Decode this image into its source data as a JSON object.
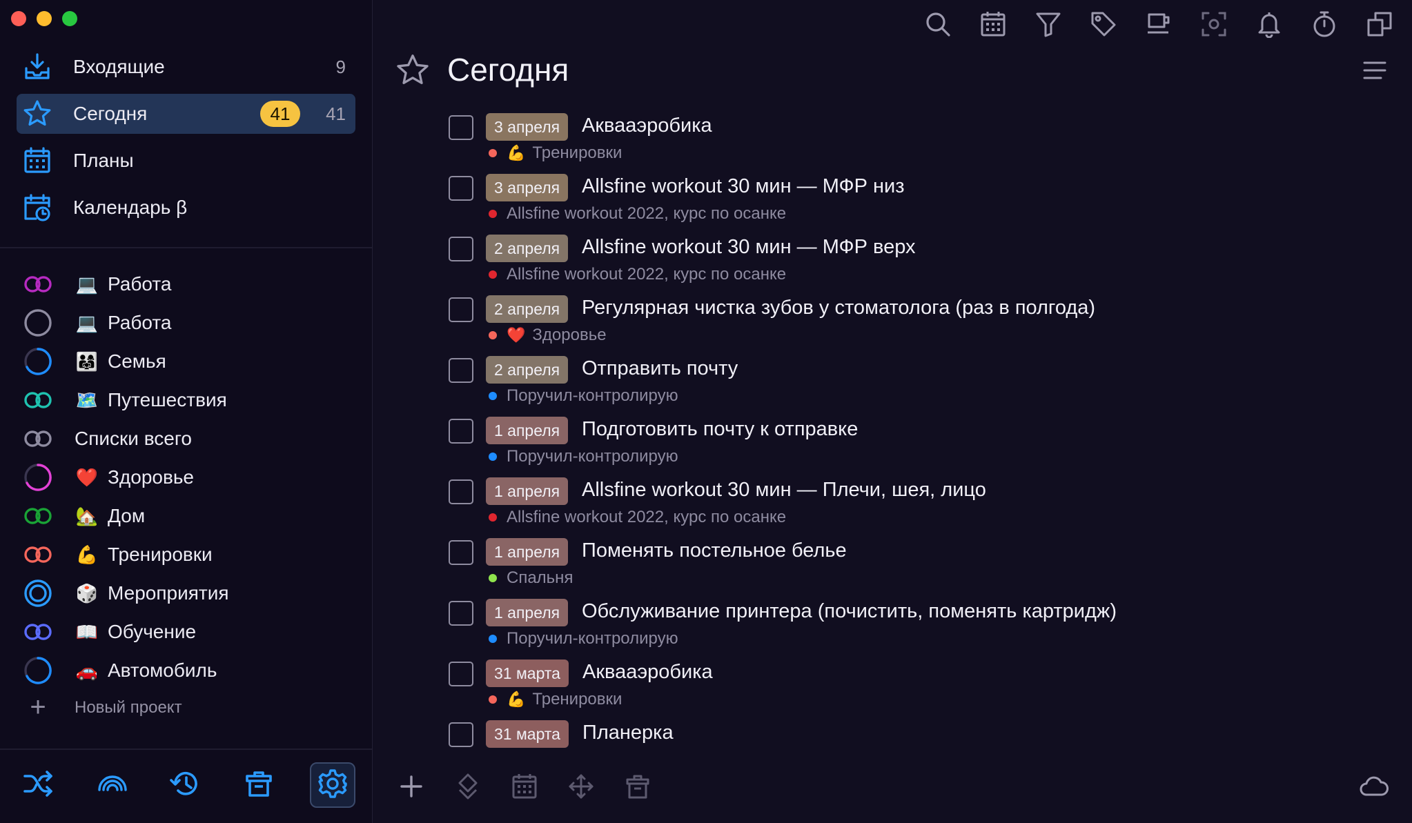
{
  "sidebar": {
    "nav": [
      {
        "label": "Входящие",
        "count": "9",
        "icon": "inbox-icon"
      },
      {
        "label": "Сегодня",
        "count": "41",
        "badge": "41",
        "icon": "star-icon",
        "active": true
      },
      {
        "label": "Планы",
        "icon": "calendar-icon"
      },
      {
        "label": "Календарь β",
        "icon": "calendar-clock-icon"
      }
    ],
    "projects": [
      {
        "emoji": "💻",
        "label": "Работа",
        "ring": "#b62ac0",
        "style": "double"
      },
      {
        "emoji": "💻",
        "label": "Работа",
        "ring": "#8e8ba0",
        "style": "circle"
      },
      {
        "emoji": "👨‍👩‍👧",
        "label": "Семья",
        "ring": "#1e8cff",
        "style": "partial"
      },
      {
        "emoji": "🗺️",
        "label": "Путешествия",
        "ring": "#1fc2b0",
        "style": "double"
      },
      {
        "emoji": "",
        "label": "Списки всего",
        "ring": "#8e8ba0",
        "style": "double"
      },
      {
        "emoji": "❤️",
        "label": "Здоровье",
        "ring": "#e341d6",
        "style": "partial"
      },
      {
        "emoji": "🏡",
        "label": "Дом",
        "ring": "#1aa336",
        "style": "double"
      },
      {
        "emoji": "💪",
        "label": "Тренировки",
        "ring": "#f5665b",
        "style": "double"
      },
      {
        "emoji": "🎲",
        "label": "Мероприятия",
        "ring": "#2b9bff",
        "style": "target"
      },
      {
        "emoji": "📖",
        "label": "Обучение",
        "ring": "#5b6cff",
        "style": "double"
      },
      {
        "emoji": "🚗",
        "label": "Автомобиль",
        "ring": "#1e8cff",
        "style": "partial"
      }
    ],
    "new_project": "Новый проект"
  },
  "main": {
    "title": "Сегодня",
    "tasks": [
      {
        "date": "3 апреля",
        "title": "Аквааэробика",
        "dot": "#f5665b",
        "emoji": "💪",
        "project": "Тренировки",
        "tag": "#8a7560"
      },
      {
        "date": "3 апреля",
        "title": "Allsfine workout 30 мин — МФР низ",
        "dot": "#e0262f",
        "emoji": "",
        "project": "Allsfine workout 2022, курс по осанке",
        "tag": "#8a7560"
      },
      {
        "date": "2 апреля",
        "title": "Allsfine workout 30 мин — МФР верх",
        "dot": "#e0262f",
        "emoji": "",
        "project": "Allsfine workout 2022, курс по осанке",
        "tag": "#837568"
      },
      {
        "date": "2 апреля",
        "title": "Регулярная чистка зубов у стоматолога (раз в полгода)",
        "dot": "#f5665b",
        "emoji": "❤️",
        "project": "Здоровье",
        "tag": "#837568"
      },
      {
        "date": "2 апреля",
        "title": "Отправить почту",
        "dot": "#1e8cff",
        "emoji": "",
        "project": "Поручил-контролирую",
        "tag": "#837568"
      },
      {
        "date": "1 апреля",
        "title": "Подготовить почту к отправке",
        "dot": "#1e8cff",
        "emoji": "",
        "project": "Поручил-контролирую",
        "tag": "#8a6565"
      },
      {
        "date": "1 апреля",
        "title": "Allsfine workout 30 мин — Плечи, шея, лицо",
        "dot": "#e0262f",
        "emoji": "",
        "project": "Allsfine workout 2022, курс по осанке",
        "tag": "#8a6565"
      },
      {
        "date": "1 апреля",
        "title": "Поменять постельное белье",
        "dot": "#8fe34d",
        "emoji": "",
        "project": "Спальня",
        "tag": "#8a6565"
      },
      {
        "date": "1 апреля",
        "title": "Обслуживание принтера (почистить, поменять картридж)",
        "dot": "#1e8cff",
        "emoji": "",
        "project": "Поручил-контролирую",
        "tag": "#8a6565"
      },
      {
        "date": "31 марта",
        "title": "Аквааэробика",
        "dot": "#f5665b",
        "emoji": "💪",
        "project": "Тренировки",
        "tag": "#8d5e5e"
      },
      {
        "date": "31 марта",
        "title": "Планерка",
        "dot": "",
        "emoji": "",
        "project": "",
        "tag": "#8d5e5e"
      }
    ]
  },
  "colors": {
    "accent": "#2b9bff",
    "badge": "#f6c341",
    "active_nav": "#233557"
  }
}
